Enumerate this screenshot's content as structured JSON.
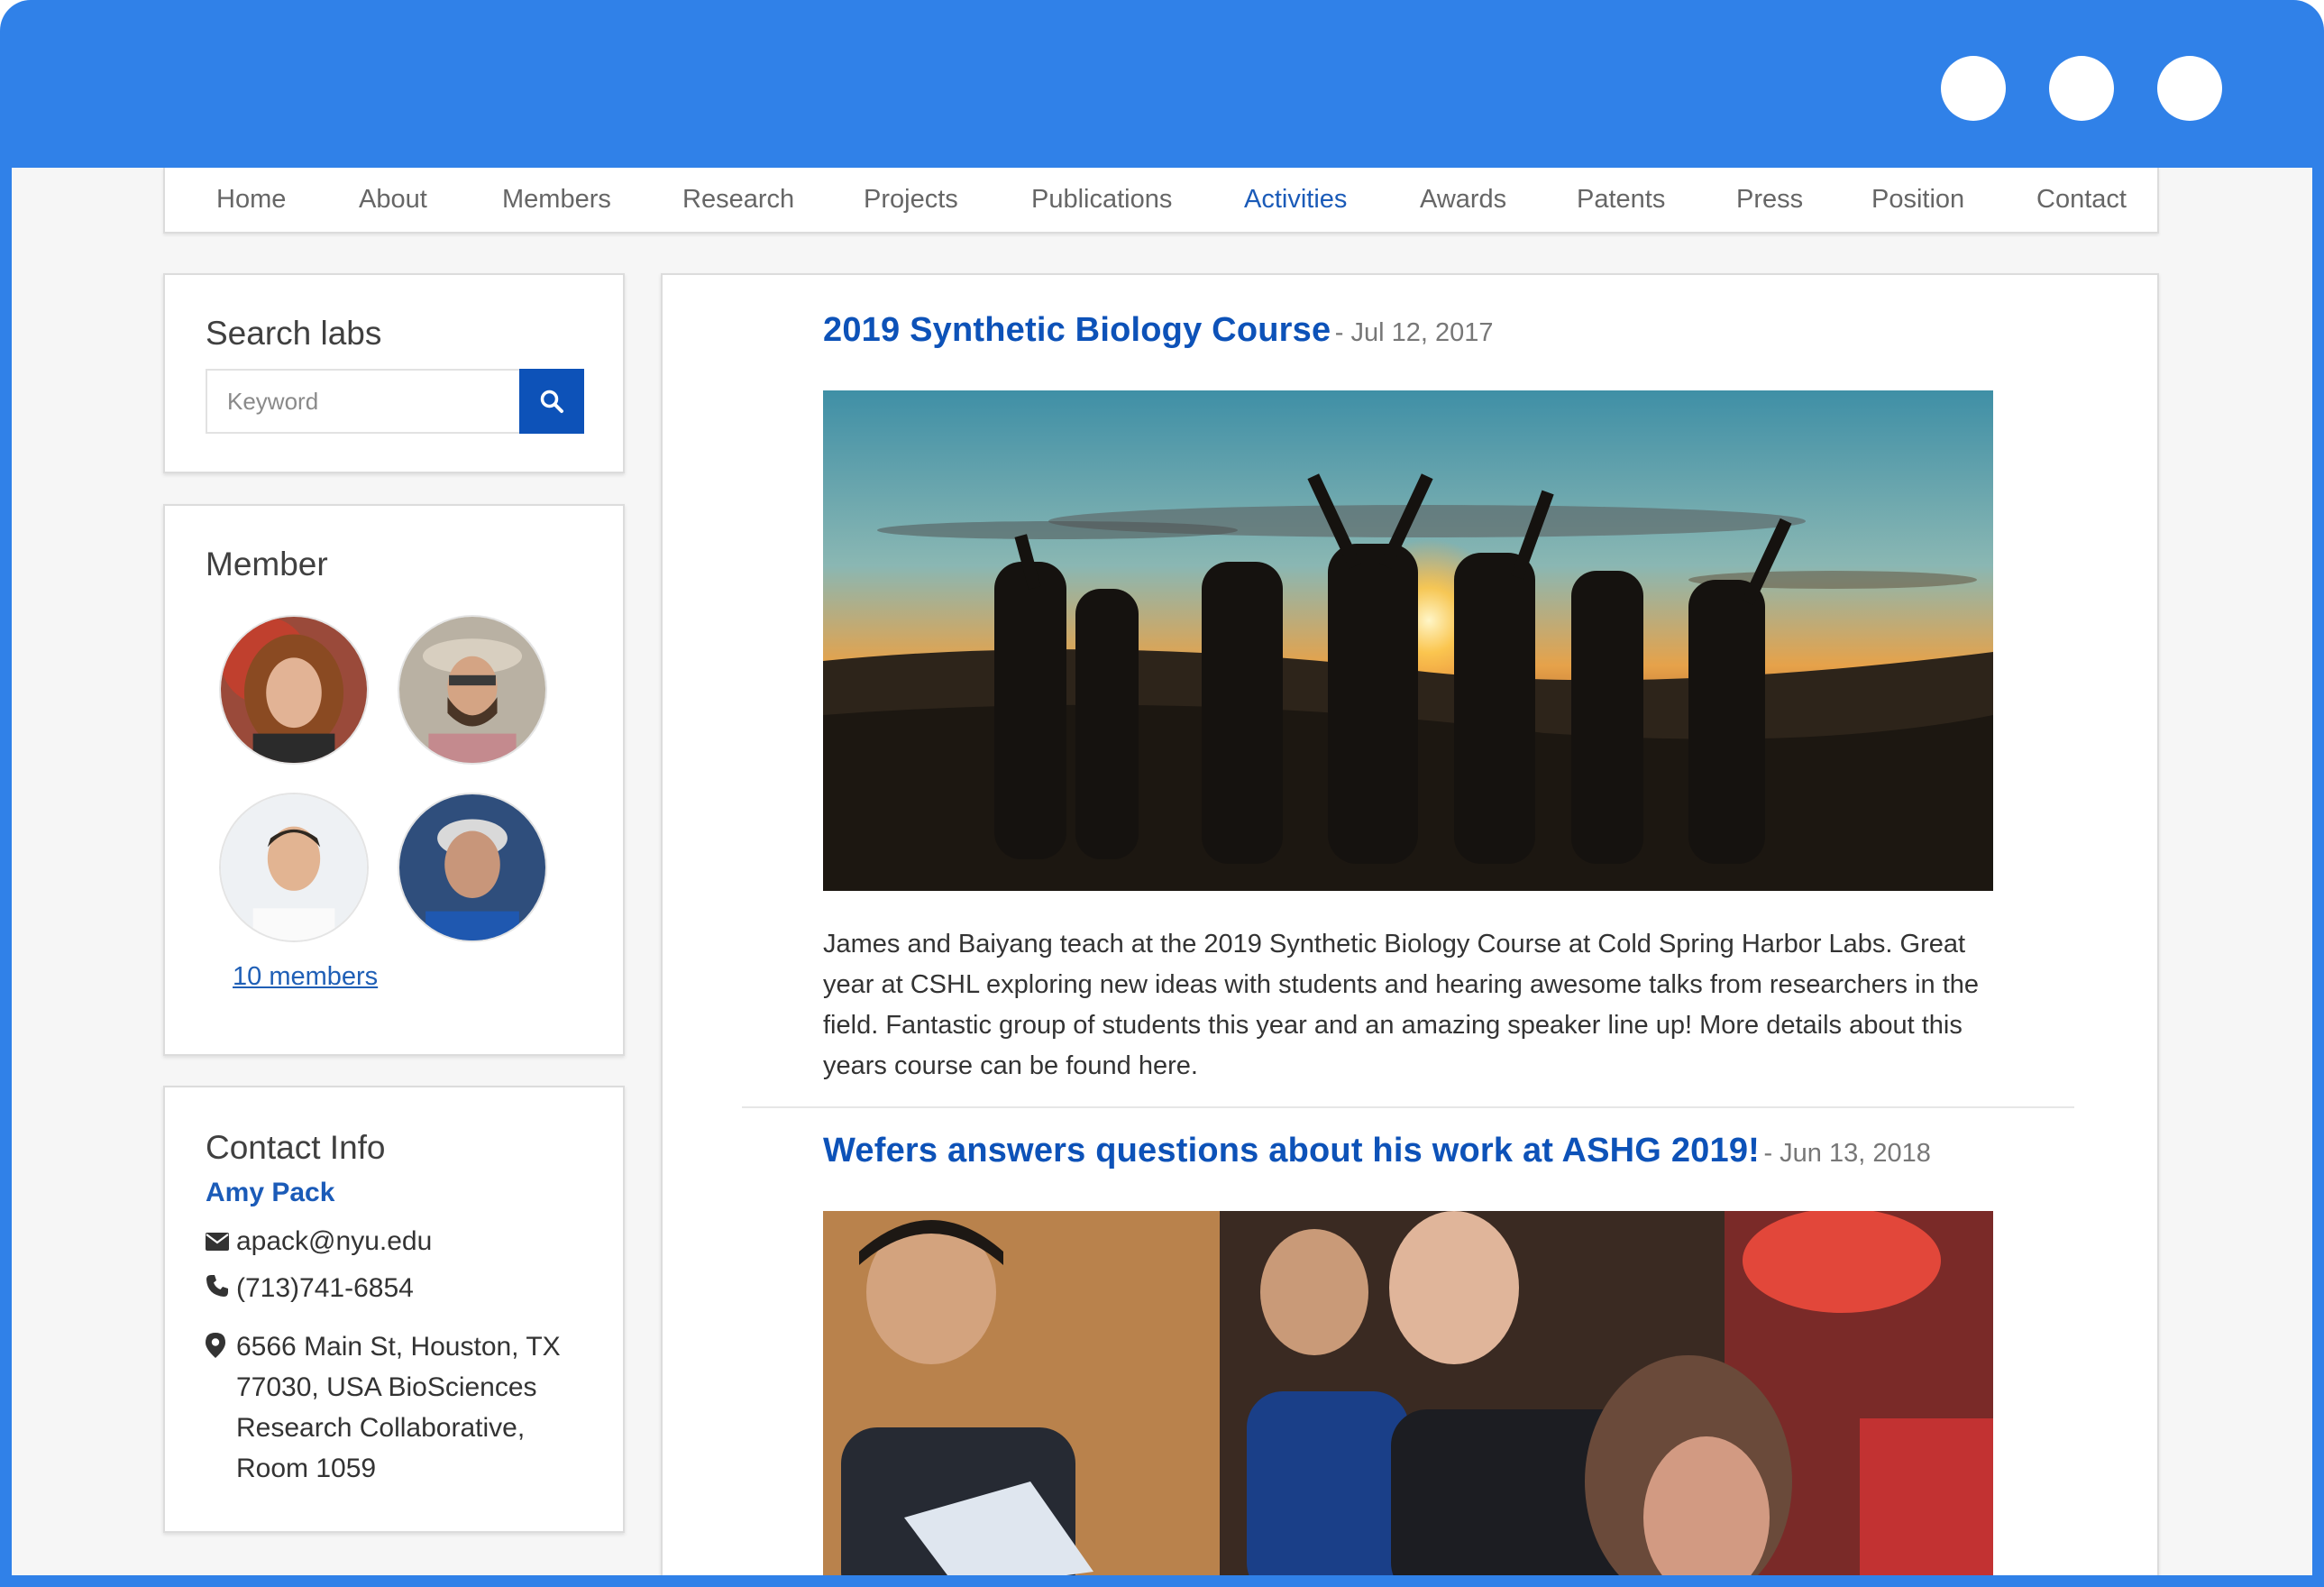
{
  "nav": {
    "items": [
      {
        "label": "Home",
        "active": false
      },
      {
        "label": "About",
        "active": false
      },
      {
        "label": "Members",
        "active": false
      },
      {
        "label": "Research",
        "active": false
      },
      {
        "label": "Projects",
        "active": false
      },
      {
        "label": "Publications",
        "active": false
      },
      {
        "label": "Activities",
        "active": true
      },
      {
        "label": "Awards",
        "active": false
      },
      {
        "label": "Patents",
        "active": false
      },
      {
        "label": "Press",
        "active": false
      },
      {
        "label": "Position",
        "active": false
      },
      {
        "label": "Contact",
        "active": false
      }
    ]
  },
  "search": {
    "title": "Search labs",
    "placeholder": "Keyword",
    "button_icon": "search-icon"
  },
  "members": {
    "title": "Member",
    "link_label": "10 members"
  },
  "contact": {
    "title": "Contact Info",
    "name": "Amy Pack",
    "email": "apack@nyu.edu",
    "phone": "(713)741-6854",
    "address": "6566 Main St, Houston, TX 77030, USA BioSciences Research Collaborative, Room 1059"
  },
  "articles": [
    {
      "title": "2019 Synthetic Biology Course",
      "date": "- Jul 12, 2017",
      "body": "James and Baiyang teach at the 2019 Synthetic Biology Course at Cold Spring Harbor Labs. Great year at CSHL exploring new ideas with students and hearing awesome talks from researchers in the field. Fantastic group of students this year and an amazing speaker line up! More details about this years course can be found here."
    },
    {
      "title": "Wefers answers questions about his work at ASHG 2019!",
      "date": "- Jun 13, 2018"
    }
  ],
  "colors": {
    "window_frame": "#3081e8",
    "accent": "#0d52b8",
    "nav_active": "#1b5bb8"
  }
}
